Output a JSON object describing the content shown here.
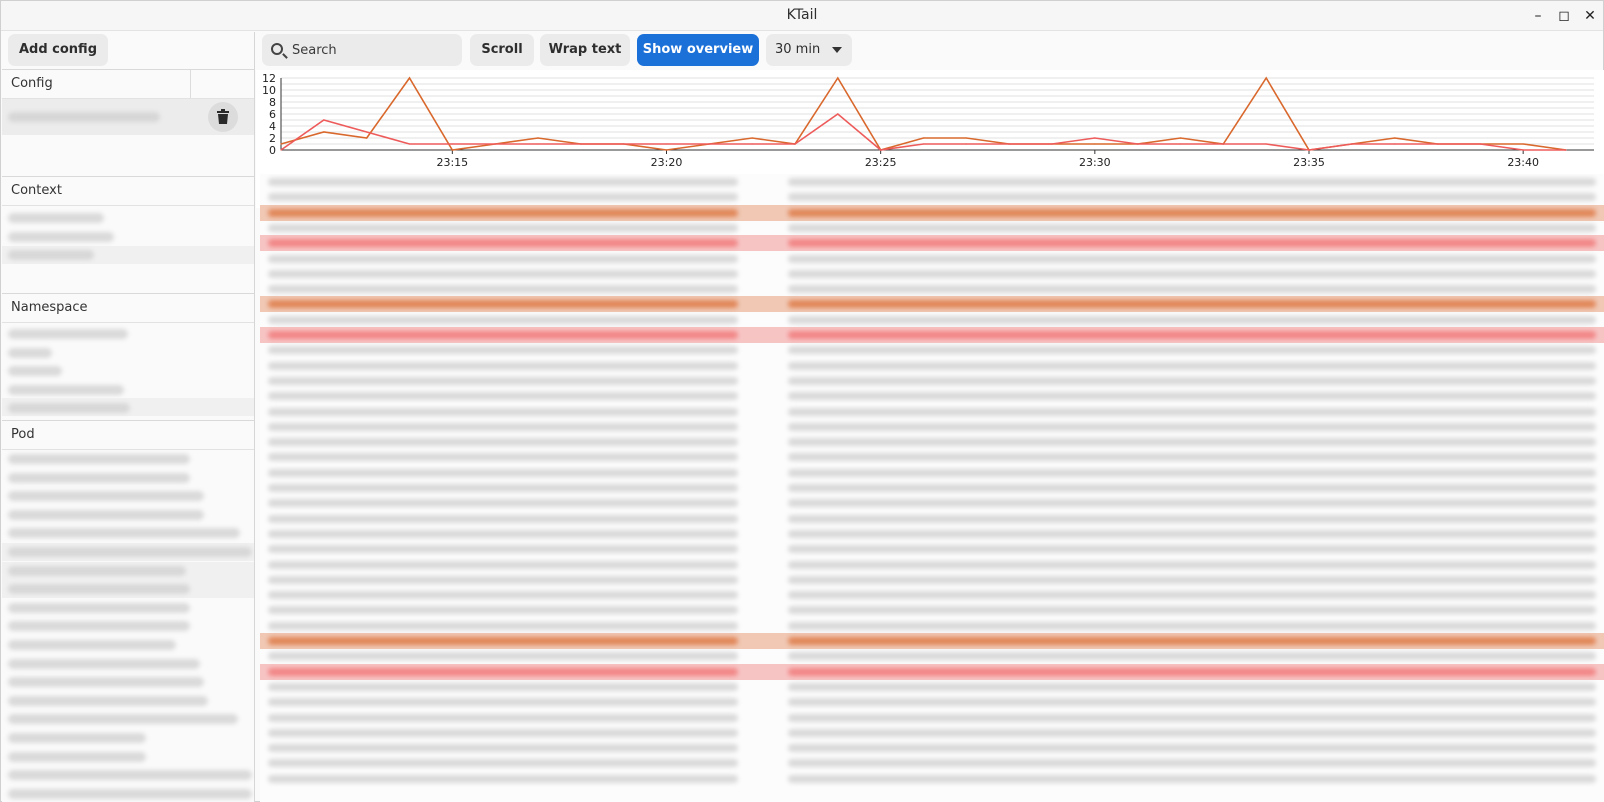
{
  "window": {
    "title": "KTail",
    "controls": [
      "minimize",
      "maximize",
      "close"
    ]
  },
  "sidebar": {
    "add_config_label": "Add config",
    "sections": {
      "config": "Config",
      "context": "Context",
      "namespace": "Namespace",
      "pod": "Pod"
    }
  },
  "toolbar": {
    "search_placeholder": "Search",
    "scroll_label": "Scroll",
    "wrap_label": "Wrap text",
    "overview_label": "Show overview",
    "range_value": "30 min"
  },
  "colors": {
    "accent": "#1c71d8",
    "warn_line": "#d9682d",
    "error_line": "#ee5b5b"
  },
  "chart_data": {
    "type": "line",
    "x": [
      "23:11",
      "23:12",
      "23:13",
      "23:14",
      "23:15",
      "23:16",
      "23:17",
      "23:18",
      "23:19",
      "23:20",
      "23:21",
      "23:22",
      "23:23",
      "23:24",
      "23:25",
      "23:26",
      "23:27",
      "23:28",
      "23:29",
      "23:30",
      "23:31",
      "23:32",
      "23:33",
      "23:34",
      "23:35",
      "23:36",
      "23:37",
      "23:38",
      "23:39",
      "23:40",
      "23:41"
    ],
    "xticks": [
      "23:15",
      "23:20",
      "23:25",
      "23:30",
      "23:35",
      "23:40"
    ],
    "yticks": [
      "0",
      "2",
      "4",
      "6",
      "8",
      "10",
      "12"
    ],
    "ylim": [
      0,
      12
    ],
    "grid": true,
    "series": [
      {
        "color": "#d9682d",
        "values": [
          1,
          3,
          2,
          12,
          0,
          1,
          2,
          1,
          1,
          0,
          1,
          2,
          1,
          12,
          0,
          2,
          2,
          1,
          1,
          1,
          1,
          2,
          1,
          12,
          0,
          1,
          2,
          1,
          1,
          1,
          0
        ]
      },
      {
        "color": "#ee5b5b",
        "values": [
          0,
          5,
          3,
          1,
          1,
          1,
          1,
          1,
          1,
          1,
          1,
          1,
          1,
          6,
          0,
          1,
          1,
          1,
          1,
          2,
          1,
          1,
          1,
          1,
          0,
          1,
          1,
          1,
          1,
          0,
          0
        ]
      }
    ]
  }
}
